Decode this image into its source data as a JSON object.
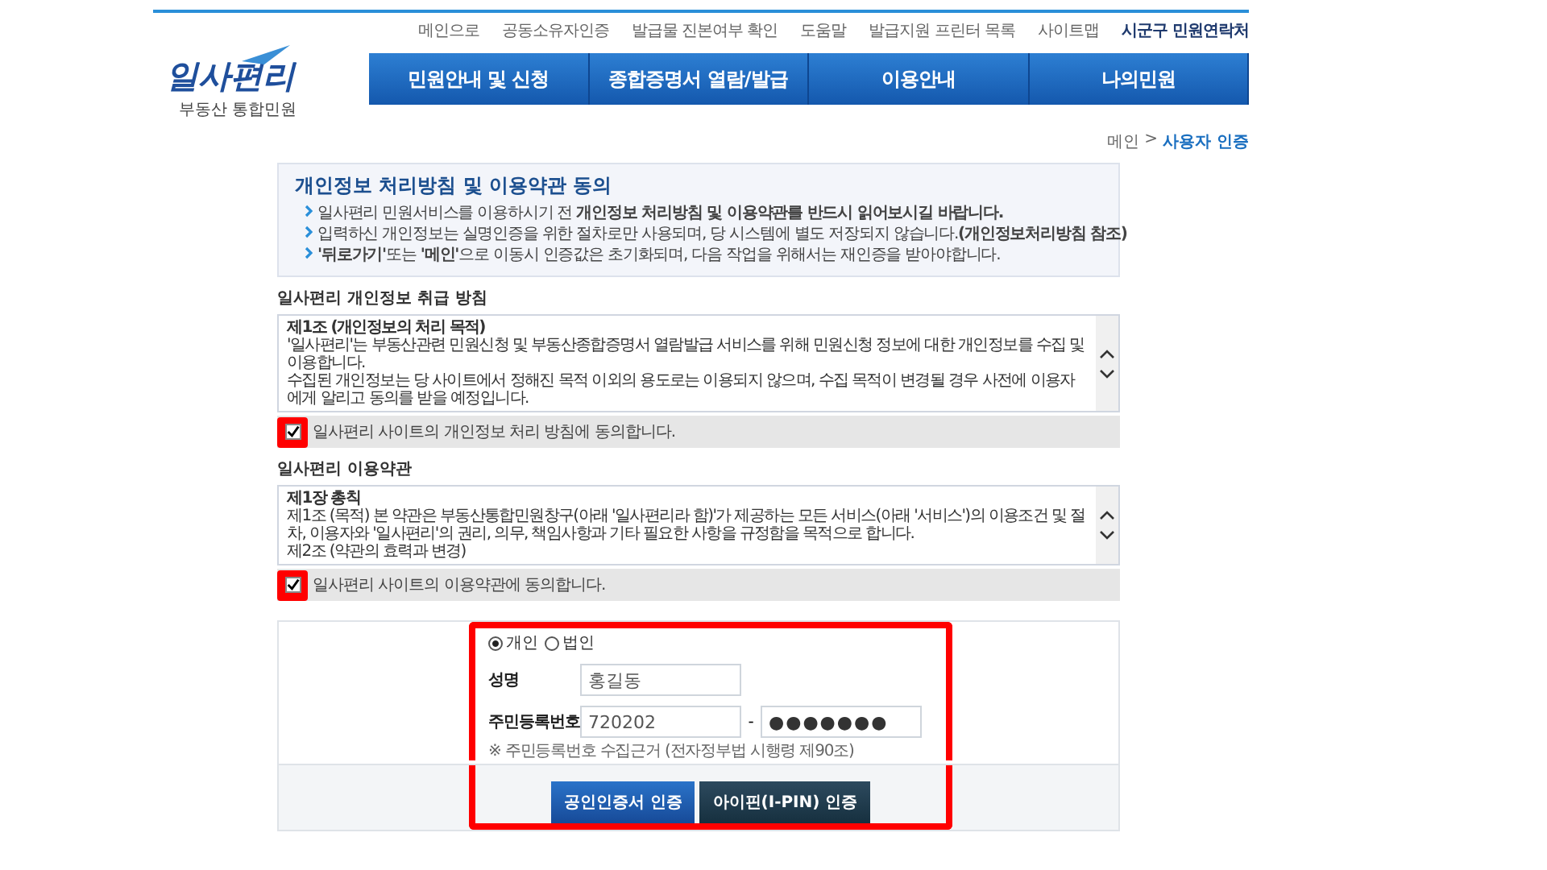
{
  "logo": {
    "name": "일사편리",
    "subtitle": "부동산 통합민원"
  },
  "util_links": [
    {
      "label": "메인으로",
      "emphasis": false
    },
    {
      "label": "공동소유자인증",
      "emphasis": false
    },
    {
      "label": "발급물 진본여부 확인",
      "emphasis": false
    },
    {
      "label": "도움말",
      "emphasis": false
    },
    {
      "label": "발급지원 프린터 목록",
      "emphasis": false
    },
    {
      "label": "사이트맵",
      "emphasis": false
    },
    {
      "label": "시군구 민원연락처",
      "emphasis": true
    }
  ],
  "nav": [
    "민원안내 및 신청",
    "종합증명서 열람/발급",
    "이용안내",
    "나의민원"
  ],
  "breadcrumb": {
    "home": "메인",
    "separator": ">",
    "current": "사용자 인증"
  },
  "intro": {
    "title": "개인정보 처리방침 및 이용약관 동의",
    "lines": [
      "일사편리 민원서비스를 이용하시기 전 **개인정보 처리방침 및 이용약관를 반드시 읽어보시길 바랍니다.**",
      "입력하신 개인정보는 실명인증을 위한 절차로만 사용되며, 당 시스템에 별도 저장되지 않습니다.**(개인정보처리방침 참조)**",
      "**'뒤로가기'**또는 **'메인'**으로 이동시 인증값은 초기화되며, 다음 작업을 위해서는 재인증을 받아야합니다."
    ]
  },
  "sections": [
    {
      "title": "일사편리 개인정보 취급 방침",
      "heading": "제1조 (개인정보의 처리 목적)",
      "lines": [
        "'일사편리'는 부동산관련 민원신청 및 부동산종합증명서 열람발급 서비스를 위해 민원신청 정보에 대한 개인정보를 수집 및 이용합니다.",
        "수집된 개인정보는 당 사이트에서 정해진 목적 이외의 용도로는 이용되지 않으며, 수집 목적이 변경될 경우 사전에 이용자에게 알리고 동의를 받을 예정입니다."
      ],
      "agree": {
        "label": "일사편리 사이트의 개인정보 처리 방침에 동의합니다.",
        "checked": true
      }
    },
    {
      "title": "일사편리 이용약관",
      "heading": "제1장 총칙",
      "lines": [
        "제1조 (목적) 본 약관은 부동산통합민원창구(아래 '일사편리라 함)'가 제공하는 모든 서비스(아래 '서비스')의 이용조건 및 절차, 이용자와 '일사편리'의 권리, 의무, 책임사항과 기타 필요한 사항을 규정함을 목적으로 합니다.",
        "제2조 (약관의 효력과 변경)"
      ],
      "agree": {
        "label": "일사편리 사이트의 이용약관에 동의합니다.",
        "checked": true
      }
    }
  ],
  "form": {
    "types": [
      {
        "label": "개인",
        "selected": true
      },
      {
        "label": "법인",
        "selected": false
      }
    ],
    "name": {
      "label": "성명",
      "value": "홍길동"
    },
    "rrn": {
      "label": "주민등록번호",
      "front": "720202",
      "separator": "-",
      "back": "●●●●●●●"
    },
    "note": "※ 주민등록번호 수집근거 (전자정부법 시행령 제90조)",
    "buttons": [
      {
        "label": "공인인증서 인증",
        "kind": "primary"
      },
      {
        "label": "아이핀(I-PIN) 인증",
        "kind": "dark"
      }
    ]
  }
}
